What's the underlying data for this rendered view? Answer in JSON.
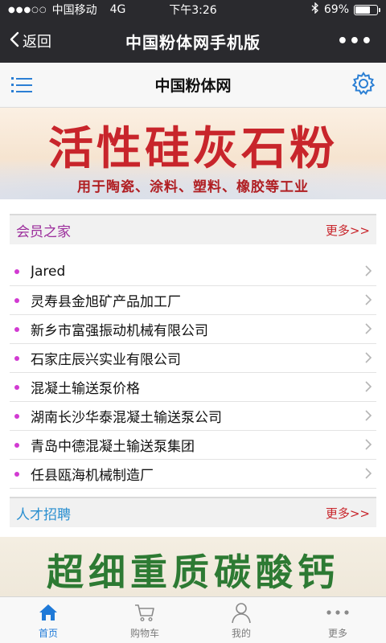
{
  "status_bar": {
    "signal_dots": "●●●○○",
    "carrier": "中国移动",
    "network": "4G",
    "time": "下午3:26",
    "battery_percent": "69%",
    "battery_level": 0.69
  },
  "navbar": {
    "back_label": "返回",
    "title": "中国粉体网手机版",
    "more_label": "•••"
  },
  "site_header": {
    "title": "中国粉体网",
    "menu_icon": "menu-icon",
    "settings_icon": "gear-icon"
  },
  "banner_top": {
    "title": "活性硅灰石粉",
    "subtitle": "用于陶瓷、涂料、塑料、橡胶等工业"
  },
  "section_members": {
    "title": "会员之家",
    "title_color": "#9b2c9b",
    "more_label": "更多>>",
    "items": [
      "Jared",
      "灵寿县金旭矿产品加工厂",
      "新乡市富强振动机械有限公司",
      "石家庄辰兴实业有限公司",
      "混凝土输送泵价格",
      "湖南长沙华泰混凝土输送泵公司",
      "青岛中德混凝土输送泵集团",
      "任县瓯海机械制造厂"
    ]
  },
  "section_jobs": {
    "title": "人才招聘",
    "title_color": "#2a8fd0",
    "more_label": "更多>>"
  },
  "banner_bottom": {
    "title": "超细重质碳酸钙"
  },
  "tabbar": {
    "tabs": [
      {
        "label": "首页",
        "icon": "home-icon",
        "active": true
      },
      {
        "label": "购物车",
        "icon": "cart-icon",
        "active": false
      },
      {
        "label": "我的",
        "icon": "user-icon",
        "active": false
      },
      {
        "label": "更多",
        "icon": "more-icon",
        "active": false
      }
    ]
  },
  "colors": {
    "accent": "#1f7ad8",
    "more_link": "#c8252b",
    "bullet": "#d23ad2"
  }
}
